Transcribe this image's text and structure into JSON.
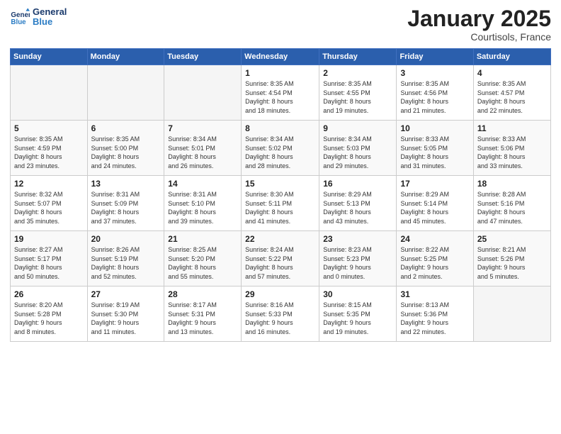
{
  "header": {
    "logo_text_general": "General",
    "logo_text_blue": "Blue",
    "month_title": "January 2025",
    "location": "Courtisols, France"
  },
  "weekdays": [
    "Sunday",
    "Monday",
    "Tuesday",
    "Wednesday",
    "Thursday",
    "Friday",
    "Saturday"
  ],
  "weeks": [
    [
      {
        "day": "",
        "detail": ""
      },
      {
        "day": "",
        "detail": ""
      },
      {
        "day": "",
        "detail": ""
      },
      {
        "day": "1",
        "detail": "Sunrise: 8:35 AM\nSunset: 4:54 PM\nDaylight: 8 hours\nand 18 minutes."
      },
      {
        "day": "2",
        "detail": "Sunrise: 8:35 AM\nSunset: 4:55 PM\nDaylight: 8 hours\nand 19 minutes."
      },
      {
        "day": "3",
        "detail": "Sunrise: 8:35 AM\nSunset: 4:56 PM\nDaylight: 8 hours\nand 21 minutes."
      },
      {
        "day": "4",
        "detail": "Sunrise: 8:35 AM\nSunset: 4:57 PM\nDaylight: 8 hours\nand 22 minutes."
      }
    ],
    [
      {
        "day": "5",
        "detail": "Sunrise: 8:35 AM\nSunset: 4:59 PM\nDaylight: 8 hours\nand 23 minutes."
      },
      {
        "day": "6",
        "detail": "Sunrise: 8:35 AM\nSunset: 5:00 PM\nDaylight: 8 hours\nand 24 minutes."
      },
      {
        "day": "7",
        "detail": "Sunrise: 8:34 AM\nSunset: 5:01 PM\nDaylight: 8 hours\nand 26 minutes."
      },
      {
        "day": "8",
        "detail": "Sunrise: 8:34 AM\nSunset: 5:02 PM\nDaylight: 8 hours\nand 28 minutes."
      },
      {
        "day": "9",
        "detail": "Sunrise: 8:34 AM\nSunset: 5:03 PM\nDaylight: 8 hours\nand 29 minutes."
      },
      {
        "day": "10",
        "detail": "Sunrise: 8:33 AM\nSunset: 5:05 PM\nDaylight: 8 hours\nand 31 minutes."
      },
      {
        "day": "11",
        "detail": "Sunrise: 8:33 AM\nSunset: 5:06 PM\nDaylight: 8 hours\nand 33 minutes."
      }
    ],
    [
      {
        "day": "12",
        "detail": "Sunrise: 8:32 AM\nSunset: 5:07 PM\nDaylight: 8 hours\nand 35 minutes."
      },
      {
        "day": "13",
        "detail": "Sunrise: 8:31 AM\nSunset: 5:09 PM\nDaylight: 8 hours\nand 37 minutes."
      },
      {
        "day": "14",
        "detail": "Sunrise: 8:31 AM\nSunset: 5:10 PM\nDaylight: 8 hours\nand 39 minutes."
      },
      {
        "day": "15",
        "detail": "Sunrise: 8:30 AM\nSunset: 5:11 PM\nDaylight: 8 hours\nand 41 minutes."
      },
      {
        "day": "16",
        "detail": "Sunrise: 8:29 AM\nSunset: 5:13 PM\nDaylight: 8 hours\nand 43 minutes."
      },
      {
        "day": "17",
        "detail": "Sunrise: 8:29 AM\nSunset: 5:14 PM\nDaylight: 8 hours\nand 45 minutes."
      },
      {
        "day": "18",
        "detail": "Sunrise: 8:28 AM\nSunset: 5:16 PM\nDaylight: 8 hours\nand 47 minutes."
      }
    ],
    [
      {
        "day": "19",
        "detail": "Sunrise: 8:27 AM\nSunset: 5:17 PM\nDaylight: 8 hours\nand 50 minutes."
      },
      {
        "day": "20",
        "detail": "Sunrise: 8:26 AM\nSunset: 5:19 PM\nDaylight: 8 hours\nand 52 minutes."
      },
      {
        "day": "21",
        "detail": "Sunrise: 8:25 AM\nSunset: 5:20 PM\nDaylight: 8 hours\nand 55 minutes."
      },
      {
        "day": "22",
        "detail": "Sunrise: 8:24 AM\nSunset: 5:22 PM\nDaylight: 8 hours\nand 57 minutes."
      },
      {
        "day": "23",
        "detail": "Sunrise: 8:23 AM\nSunset: 5:23 PM\nDaylight: 9 hours\nand 0 minutes."
      },
      {
        "day": "24",
        "detail": "Sunrise: 8:22 AM\nSunset: 5:25 PM\nDaylight: 9 hours\nand 2 minutes."
      },
      {
        "day": "25",
        "detail": "Sunrise: 8:21 AM\nSunset: 5:26 PM\nDaylight: 9 hours\nand 5 minutes."
      }
    ],
    [
      {
        "day": "26",
        "detail": "Sunrise: 8:20 AM\nSunset: 5:28 PM\nDaylight: 9 hours\nand 8 minutes."
      },
      {
        "day": "27",
        "detail": "Sunrise: 8:19 AM\nSunset: 5:30 PM\nDaylight: 9 hours\nand 11 minutes."
      },
      {
        "day": "28",
        "detail": "Sunrise: 8:17 AM\nSunset: 5:31 PM\nDaylight: 9 hours\nand 13 minutes."
      },
      {
        "day": "29",
        "detail": "Sunrise: 8:16 AM\nSunset: 5:33 PM\nDaylight: 9 hours\nand 16 minutes."
      },
      {
        "day": "30",
        "detail": "Sunrise: 8:15 AM\nSunset: 5:35 PM\nDaylight: 9 hours\nand 19 minutes."
      },
      {
        "day": "31",
        "detail": "Sunrise: 8:13 AM\nSunset: 5:36 PM\nDaylight: 9 hours\nand 22 minutes."
      },
      {
        "day": "",
        "detail": ""
      }
    ]
  ]
}
